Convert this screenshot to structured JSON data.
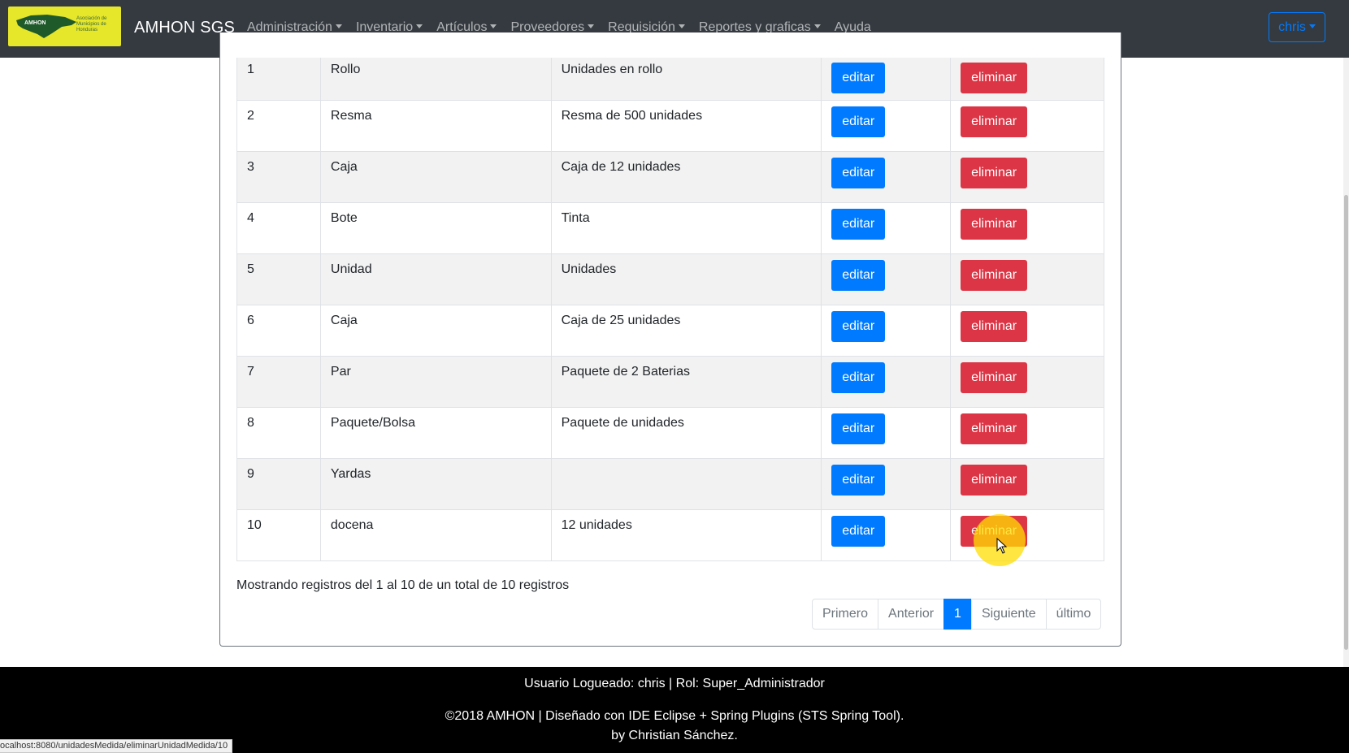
{
  "navbar": {
    "logo_text": "AMHON",
    "logo_subtitle": "Asociación de Municipios de Honduras",
    "brand": "AMHON SGS",
    "menu": [
      {
        "label": "Administración",
        "dropdown": true
      },
      {
        "label": "Inventario",
        "dropdown": true
      },
      {
        "label": "Artículos",
        "dropdown": true
      },
      {
        "label": "Proveedores",
        "dropdown": true
      },
      {
        "label": "Requisición",
        "dropdown": true
      },
      {
        "label": "Reportes y graficas",
        "dropdown": true
      },
      {
        "label": "Ayuda",
        "dropdown": false
      }
    ],
    "user": "chris"
  },
  "table": {
    "rows": [
      {
        "id": "1",
        "name": "Rollo",
        "description": "Unidades en rollo"
      },
      {
        "id": "2",
        "name": "Resma",
        "description": "Resma de 500 unidades"
      },
      {
        "id": "3",
        "name": "Caja",
        "description": "Caja de 12 unidades"
      },
      {
        "id": "4",
        "name": "Bote",
        "description": "Tinta"
      },
      {
        "id": "5",
        "name": "Unidad",
        "description": "Unidades"
      },
      {
        "id": "6",
        "name": "Caja",
        "description": "Caja de 25 unidades"
      },
      {
        "id": "7",
        "name": "Par",
        "description": "Paquete de 2 Baterias"
      },
      {
        "id": "8",
        "name": "Paquete/Bolsa",
        "description": "Paquete de unidades"
      },
      {
        "id": "9",
        "name": "Yardas",
        "description": ""
      },
      {
        "id": "10",
        "name": "docena",
        "description": "12 unidades"
      }
    ],
    "edit_label": "editar",
    "delete_label": "eliminar"
  },
  "info": "Mostrando registros del 1 al 10 de un total de 10 registros",
  "pagination": {
    "first": "Primero",
    "prev": "Anterior",
    "current": "1",
    "next": "Siguiente",
    "last": "último"
  },
  "footer": {
    "user_line": "Usuario Logueado: chris | Rol: Super_Administrador",
    "copyright": "©2018 AMHON | Diseñado con IDE Eclipse + Spring Plugins (STS Spring Tool).",
    "author": "by Christian Sánchez."
  },
  "status_url": "ocalhost:8080/unidadesMedida/eliminarUnidadMedida/10",
  "colors": {
    "navbar": "#343a40",
    "primary": "#007bff",
    "danger": "#dc3545",
    "logo_bg": "#e6e62a",
    "footer": "#000000"
  }
}
